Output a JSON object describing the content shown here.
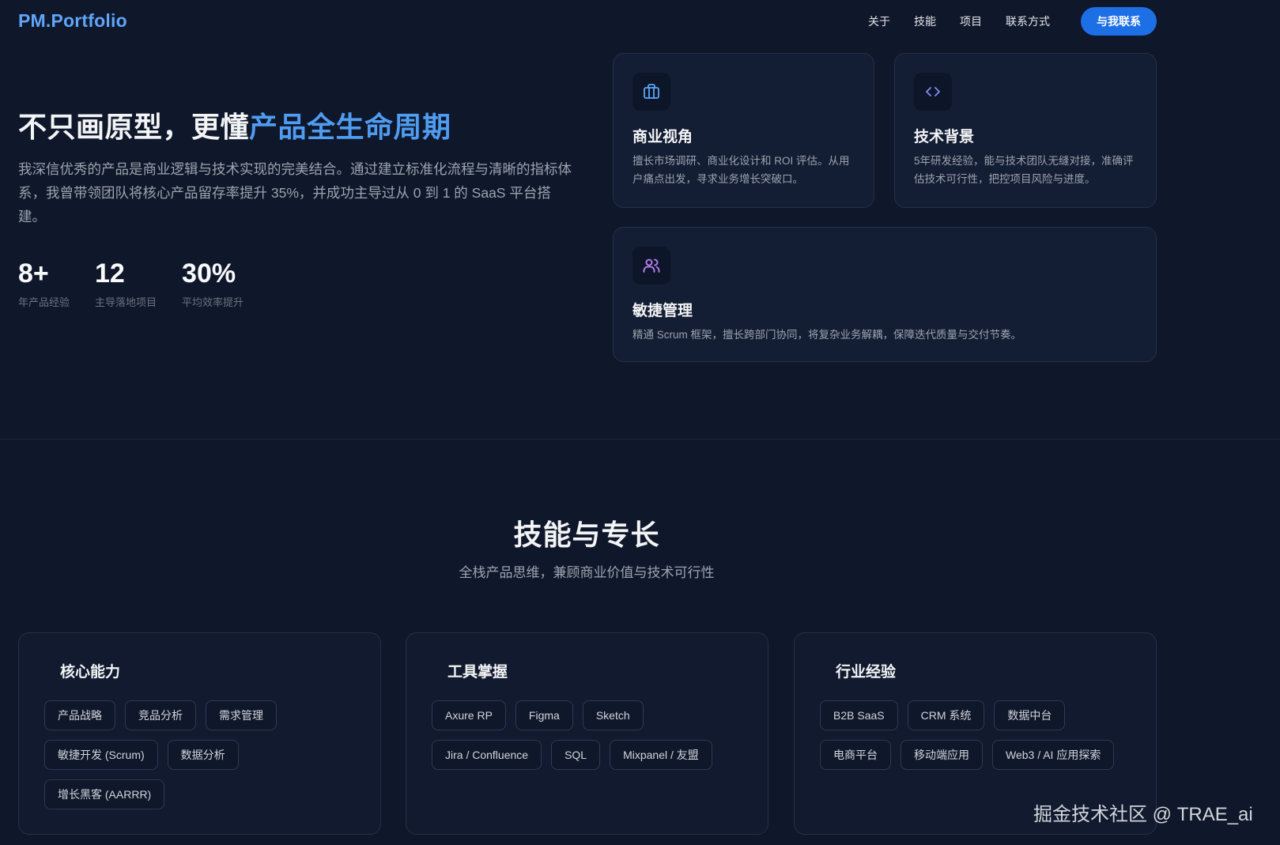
{
  "nav": {
    "logo": "PM.Portfolio",
    "links": [
      "关于",
      "技能",
      "项目",
      "联系方式"
    ],
    "cta": "与我联系"
  },
  "hero": {
    "title_plain": "不只画原型，更懂",
    "title_highlight": "产品全生命周期",
    "description": "我深信优秀的产品是商业逻辑与技术实现的完美结合。通过建立标准化流程与清晰的指标体系，我曾带领团队将核心产品留存率提升 35%，并成功主导过从 0 到 1 的 SaaS 平台搭建。",
    "stats": [
      {
        "value": "8+",
        "label": "年产品经验"
      },
      {
        "value": "12",
        "label": "主导落地项目"
      },
      {
        "value": "30%",
        "label": "平均效率提升"
      }
    ]
  },
  "feature_cards": [
    {
      "icon": "briefcase-icon",
      "title": "商业视角",
      "desc": "擅长市场调研、商业化设计和 ROI 评估。从用户痛点出发，寻求业务增长突破口。"
    },
    {
      "icon": "code-icon",
      "title": "技术背景",
      "desc": "5年研发经验，能与技术团队无缝对接，准确评估技术可行性，把控项目风险与进度。"
    },
    {
      "icon": "users-icon",
      "title": "敏捷管理",
      "desc": "精通 Scrum 框架，擅长跨部门协同，将复杂业务解耦，保障迭代质量与交付节奏。"
    }
  ],
  "skills": {
    "title": "技能与专长",
    "subtitle": "全栈产品思维，兼顾商业价值与技术可行性",
    "groups": [
      {
        "title": "核心能力",
        "tags": [
          "产品战略",
          "竞品分析",
          "需求管理",
          "敏捷开发 (Scrum)",
          "数据分析",
          "增长黑客 (AARRR)"
        ]
      },
      {
        "title": "工具掌握",
        "tags": [
          "Axure RP",
          "Figma",
          "Sketch",
          "Jira / Confluence",
          "SQL",
          "Mixpanel / 友盟"
        ]
      },
      {
        "title": "行业经验",
        "tags": [
          "B2B SaaS",
          "CRM 系统",
          "数据中台",
          "电商平台",
          "移动端应用",
          "Web3 / AI 应用探索"
        ]
      }
    ]
  },
  "colors": {
    "background": "#0f172a",
    "accent": "#4f9cf0",
    "cta": "#1d6fe6",
    "icon_blue": "#60a5fa",
    "icon_indigo": "#818cf8",
    "icon_purple": "#c084fc"
  },
  "watermark": "掘金技术社区 @ TRAE_ai"
}
